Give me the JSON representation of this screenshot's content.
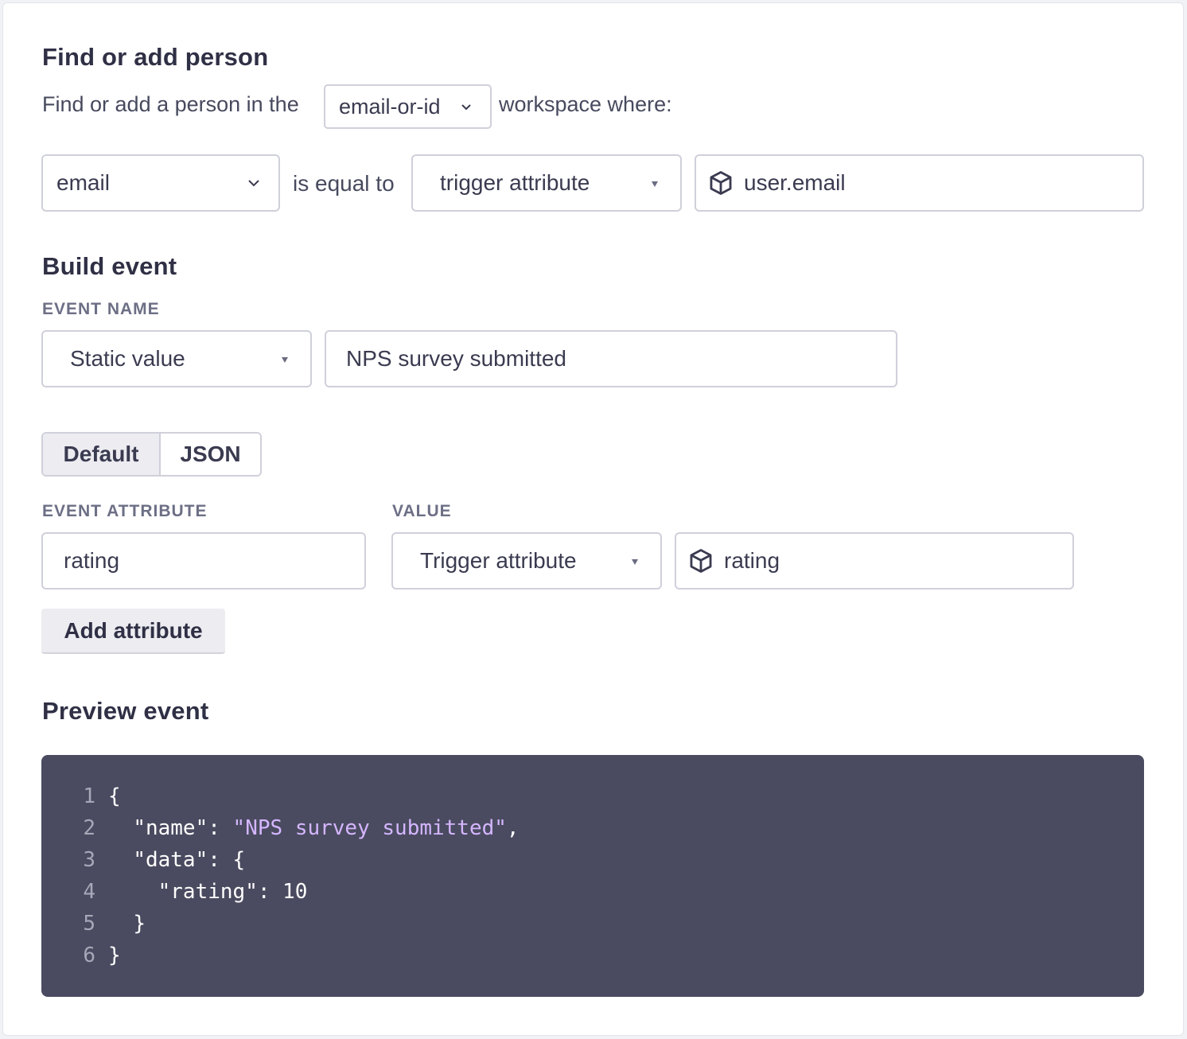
{
  "find_person": {
    "title": "Find or add person",
    "sentence_prefix": "Find or add a person in the",
    "workspace_select": "email-or-id",
    "sentence_suffix": "workspace where:",
    "field_select": "email",
    "operator_text": "is equal to",
    "value_type_select": "trigger attribute",
    "value_input": "user.email",
    "value_icon": "cube-icon"
  },
  "build_event": {
    "title": "Build event",
    "event_name_label": "EVENT NAME",
    "event_name_type": "Static value",
    "event_name_value": "NPS survey submitted",
    "mode_tabs": [
      {
        "label": "Default",
        "active": true
      },
      {
        "label": "JSON",
        "active": false
      }
    ],
    "attribute_label": "EVENT ATTRIBUTE",
    "value_label": "VALUE",
    "attributes": [
      {
        "name": "rating",
        "value_type": "Trigger attribute",
        "value": "rating",
        "value_icon": "cube-icon"
      }
    ],
    "add_attribute_label": "Add attribute"
  },
  "preview": {
    "title": "Preview event",
    "lines": [
      {
        "n": "1",
        "indent": "",
        "key": "",
        "punct": "{",
        "str": "",
        "tail": ""
      },
      {
        "n": "2",
        "indent": "  ",
        "key": "\"name\": ",
        "punct": "",
        "str": "\"NPS survey submitted\"",
        "tail": ","
      },
      {
        "n": "3",
        "indent": "  ",
        "key": "\"data\": {",
        "punct": "",
        "str": "",
        "tail": ""
      },
      {
        "n": "4",
        "indent": "    ",
        "key": "\"rating\": 10",
        "punct": "",
        "str": "",
        "tail": ""
      },
      {
        "n": "5",
        "indent": "  ",
        "key": "",
        "punct": "}",
        "str": "",
        "tail": ""
      },
      {
        "n": "6",
        "indent": "",
        "key": "",
        "punct": "}",
        "str": "",
        "tail": ""
      }
    ]
  },
  "colors": {
    "code_bg": "#4a4b60",
    "code_string": "#d5b6ff",
    "segment_active_bg": "#ececf1"
  }
}
